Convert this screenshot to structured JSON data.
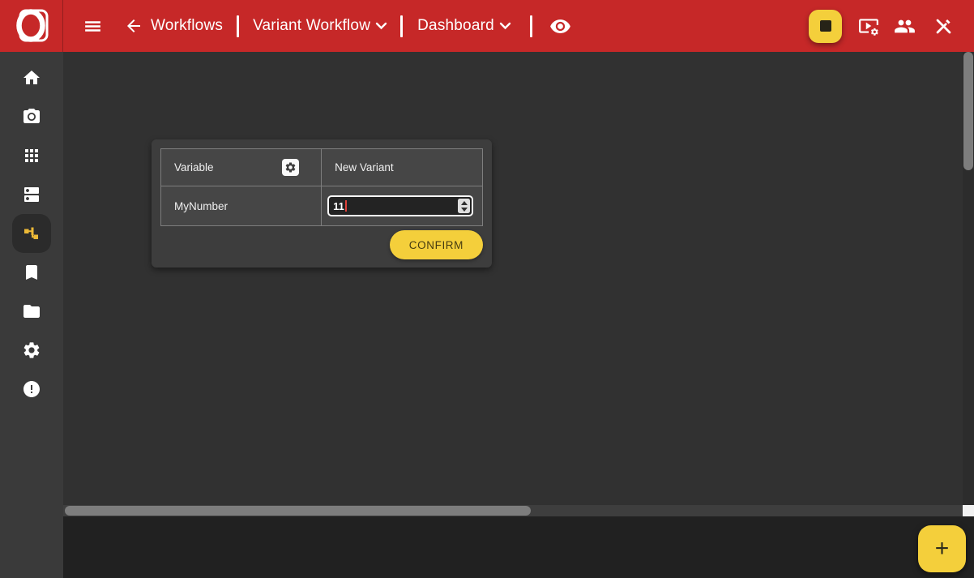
{
  "colors": {
    "topbar_red": "#c62828",
    "accent_yellow": "#f4cf3b",
    "active_icon_yellow": "#ecb937",
    "main_bg": "#313131",
    "card_bg": "#3d3d3d"
  },
  "topbar": {
    "logo_letter": "O",
    "back_section_label": "Workflows",
    "workflow_selector_value": "Variant Workflow",
    "view_selector_value": "Dashboard",
    "right_icons": [
      "stop-icon",
      "video-settings-icon",
      "group-icon",
      "edit-off-icon"
    ]
  },
  "sidebar": {
    "items": [
      {
        "name": "home",
        "icon": "home-icon",
        "active": false
      },
      {
        "name": "camera",
        "icon": "camera-icon",
        "active": false
      },
      {
        "name": "apps",
        "icon": "apps-grid-icon",
        "active": false
      },
      {
        "name": "dns",
        "icon": "dns-icon",
        "active": false
      },
      {
        "name": "workflows",
        "icon": "schema-icon",
        "active": true
      },
      {
        "name": "bookmarks",
        "icon": "bookmark-icon",
        "active": false
      },
      {
        "name": "files",
        "icon": "folder-icon",
        "active": false
      },
      {
        "name": "settings",
        "icon": "gear-icon",
        "active": false
      },
      {
        "name": "alerts",
        "icon": "error-icon",
        "active": false
      }
    ]
  },
  "variant_panel": {
    "columns": [
      "Variable",
      "New Variant"
    ],
    "rows": [
      {
        "variable": "MyNumber",
        "value": "11"
      }
    ],
    "confirm_label": "CONFIRM"
  },
  "fab_label": "+"
}
